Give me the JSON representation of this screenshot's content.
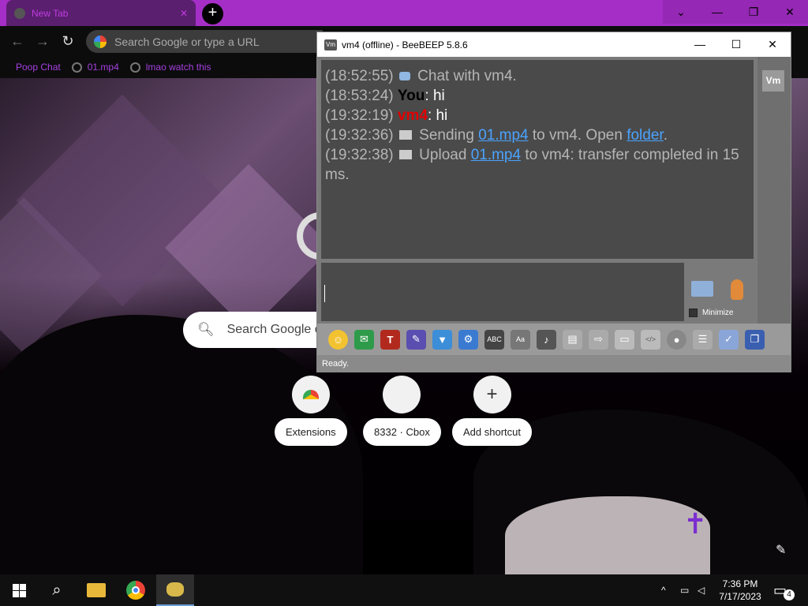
{
  "browser": {
    "tab_title": "New Tab",
    "tab_close": "✕",
    "new_tab": "+",
    "omnibox_placeholder": "Search Google or type a URL",
    "bookmarks": [
      {
        "label": "Poop Chat"
      },
      {
        "label": "01.mp4"
      },
      {
        "label": "lmao watch this"
      }
    ],
    "window_controls": {
      "minimize": "—",
      "restore": "❐",
      "close": "✕",
      "tabsearch": "⌄"
    }
  },
  "ntp": {
    "search_placeholder": "Search Google o",
    "shortcuts": [
      {
        "label": "Extensions",
        "icon": "chrome-web-store-icon"
      },
      {
        "label": "8332 · Cbox",
        "icon": "blank-site-icon"
      },
      {
        "label": "Add shortcut",
        "icon": "plus-icon",
        "glyph": "+"
      }
    ],
    "customize_icon": "✎"
  },
  "beebeep": {
    "title": "vm4 (offline) - BeeBEEP 5.8.6",
    "app_icon_text": "Vm",
    "controls": {
      "minimize": "—",
      "maximize": "☐",
      "close": "✕"
    },
    "chat": [
      {
        "time": "(18:52:55)",
        "type": "system",
        "text": " Chat with vm4."
      },
      {
        "time": "(18:53:24)",
        "type": "you",
        "sender": "You",
        "text": ": hi"
      },
      {
        "time": "(19:32:19)",
        "type": "peer",
        "sender": "vm4",
        "text": ": hi"
      },
      {
        "time": "(19:32:36)",
        "type": "file",
        "pre": " Sending ",
        "link": "01.mp4",
        "mid": " to vm4. Open ",
        "link2": "folder",
        "post": "."
      },
      {
        "time": "(19:32:38)",
        "type": "file",
        "pre": " Upload ",
        "link": "01.mp4",
        "mid": " to vm4: transfer completed in 15 ms."
      }
    ],
    "member_label": "Vm",
    "minimize_label": "Minimize",
    "status": "Ready.",
    "toolbar_icons": [
      "emoticon-icon",
      "send-file-icon",
      "font-icon",
      "color-icon",
      "filter-icon",
      "settings-icon",
      "spellcheck-icon",
      "dictionary-icon",
      "note-icon",
      "document-icon",
      "file-transfer-icon",
      "save-chat-icon",
      "html-icon",
      "screenshot-icon",
      "clear-icon",
      "edit-icon",
      "detach-icon"
    ]
  },
  "taskbar": {
    "time": "7:36 PM",
    "date": "7/17/2023",
    "notifications": "4",
    "tray_chevron": "^"
  }
}
